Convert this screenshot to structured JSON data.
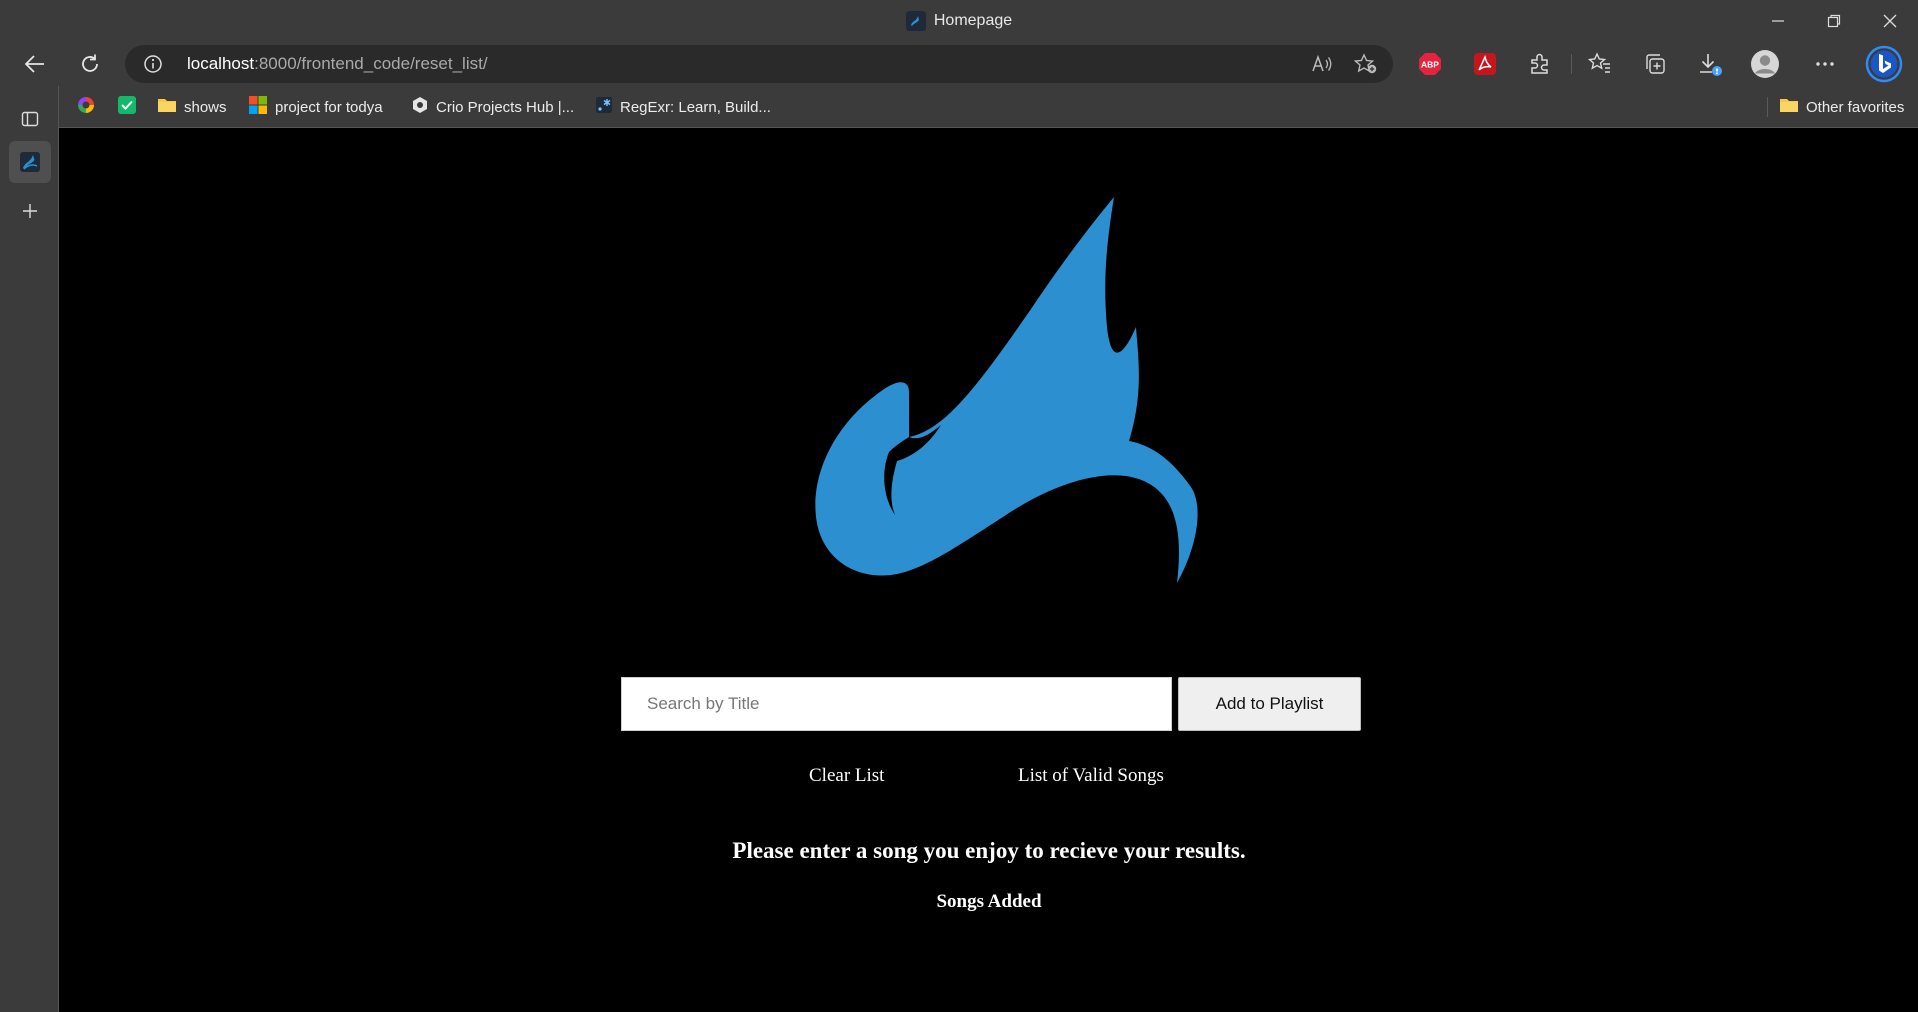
{
  "window": {
    "title": "Homepage",
    "favicon_icon": "site-logo-icon"
  },
  "window_controls": [
    "minimize-icon",
    "restore-icon",
    "close-icon"
  ],
  "toolbar": {
    "back_icon": "back-arrow-icon",
    "refresh_icon": "refresh-icon",
    "address": {
      "host": "localhost",
      "path": ":8000/frontend_code/reset_list/",
      "info_icon": "info-icon",
      "read_aloud_icon": "read-aloud-icon",
      "add_favorite_icon": "add-favorite-icon"
    },
    "extensions": [
      {
        "name": "adblock-plus-icon",
        "text": "ABP",
        "color": "#e4243e"
      },
      {
        "name": "adobe-acrobat-icon",
        "color": "#c4161c"
      },
      {
        "name": "extensions-icon"
      }
    ],
    "right_icons": [
      "favorites-icon",
      "collections-icon",
      "downloads-icon",
      "profile-icon",
      "more-icon",
      "bing-icon"
    ]
  },
  "bookmarks": {
    "items": [
      {
        "label": "",
        "icon": "colorful-circle-icon"
      },
      {
        "label": "",
        "icon": "green-check-icon"
      },
      {
        "label": "shows",
        "icon": "folder-icon"
      },
      {
        "label": "project for todya",
        "icon": "microsoft-icon"
      },
      {
        "label": "Crio Projects Hub |...",
        "icon": "crio-icon"
      },
      {
        "label": "RegExr: Learn, Build...",
        "icon": "regexr-icon"
      }
    ],
    "other_favorites": "Other favorites"
  },
  "sidebar": {
    "items": [
      "tab-actions-icon",
      "active-tab-icon",
      "new-tab-icon"
    ]
  },
  "page": {
    "logo_color": "#2b8fd0",
    "search": {
      "placeholder": "Search by Title",
      "value": ""
    },
    "add_button": "Add to Playlist",
    "clear_list": "Clear List",
    "valid_songs": "List of Valid Songs",
    "message": "Please enter a song you enjoy to recieve your results.",
    "songs_added": "Songs Added"
  }
}
